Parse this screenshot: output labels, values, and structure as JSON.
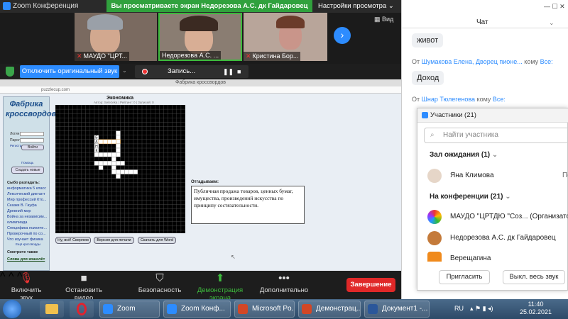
{
  "zoom": {
    "window_title": "Zoom Конференция",
    "viewing_banner": "Вы просматриваете экран Недорезова А.С. дк Гайдаровец",
    "view_settings": "Настройки просмотра",
    "view_mode": "Вид",
    "participants_tiles": [
      {
        "name": "МАУДО \"ЦРТ..."
      },
      {
        "name": "Недорезова А.С. ..."
      },
      {
        "name": "Кристина Бор..."
      }
    ],
    "stop_original_sound": "Отключить оригинальный звук",
    "recording": "Запись...",
    "toolbar": {
      "mute": "Включить звук",
      "video": "Остановить видео",
      "security": "Безопасность",
      "share": "Демонстрация экрана",
      "more": "Дополнительно",
      "end": "Завершение"
    }
  },
  "browser": {
    "tab_title": "Фабрика кроссвордов",
    "url": "puzzlecup.com"
  },
  "site": {
    "logo": "Фабрика кроссвордов",
    "login_label": "Логин",
    "password_label": "Пароль",
    "login_button": "Войти",
    "register": "Регистрация",
    "help": "Помощь",
    "create_new": "Создать новые",
    "puzzles_heading": "Сыбо разгадать:",
    "puzzle_links": [
      "информатика 5 класс",
      "Лексический диктант",
      "Мир профессий Кто...",
      "Сказки В. Гауфа",
      "Древний мир",
      "Война за независим...",
      "олимпиада",
      "Специфика психиче...",
      "Проверочный по со...",
      "Что изучает физика"
    ],
    "more_link": "Ещё кроссворды",
    "see_also": "Смотрите также",
    "dictionary_link": "Слова для кошелёт"
  },
  "crossword": {
    "title": "Экономика",
    "meta": "Автор: Selezeka | Рейтинг: 0 | Записей: 0",
    "letters": [
      "Б",
      "А",
      "Н",
      "К"
    ],
    "answers_heading": "Отгадываем:",
    "clue": "Публичная продажа товаров, ценных бумаг, имущества, произведений искусства по принципу состязательности.",
    "buttons": [
      "Ну, всё! Сверяем",
      "Версия для печати",
      "Скачать для Word"
    ]
  },
  "chat": {
    "title": "Чат",
    "messages": [
      {
        "text": "живот"
      },
      {
        "from_prefix": "От",
        "from": "Шумакова Елена, Дворец пионе...",
        "to_prefix": "кому",
        "to": "Всe:"
      },
      {
        "text": "Доход"
      },
      {
        "from_prefix": "От",
        "from": "Шнар Тюлегенова",
        "to_prefix": "кому",
        "to": "Всe:"
      }
    ]
  },
  "participants": {
    "title": "Участники (21)",
    "search_placeholder": "Найти участника",
    "waiting_heading": "Зал ожидания (1)",
    "waiting": [
      {
        "name": "Яна Климова",
        "action": "По"
      }
    ],
    "conference_heading": "На конференции (21)",
    "people": [
      {
        "name": "МАУДО \"ЦРТДЮ \"Соз... (Организатор, я)"
      },
      {
        "name": "Недорезова А.С. дк Гайдаровец"
      },
      {
        "name": "Верещагина"
      }
    ],
    "invite": "Пригласить",
    "mute_all": "Выкл. весь звук"
  },
  "taskbar": {
    "items": [
      "Zoom",
      "Zoom Конф...",
      "Microsoft Po...",
      "Демонстрац...",
      "Документ1 -..."
    ],
    "lang": "RU",
    "time": "11:40",
    "date": "25.02.2021"
  },
  "colors": {
    "zoom_blue": "#2d8cff",
    "banner_green": "#30a13d",
    "end_red": "#e02828"
  }
}
